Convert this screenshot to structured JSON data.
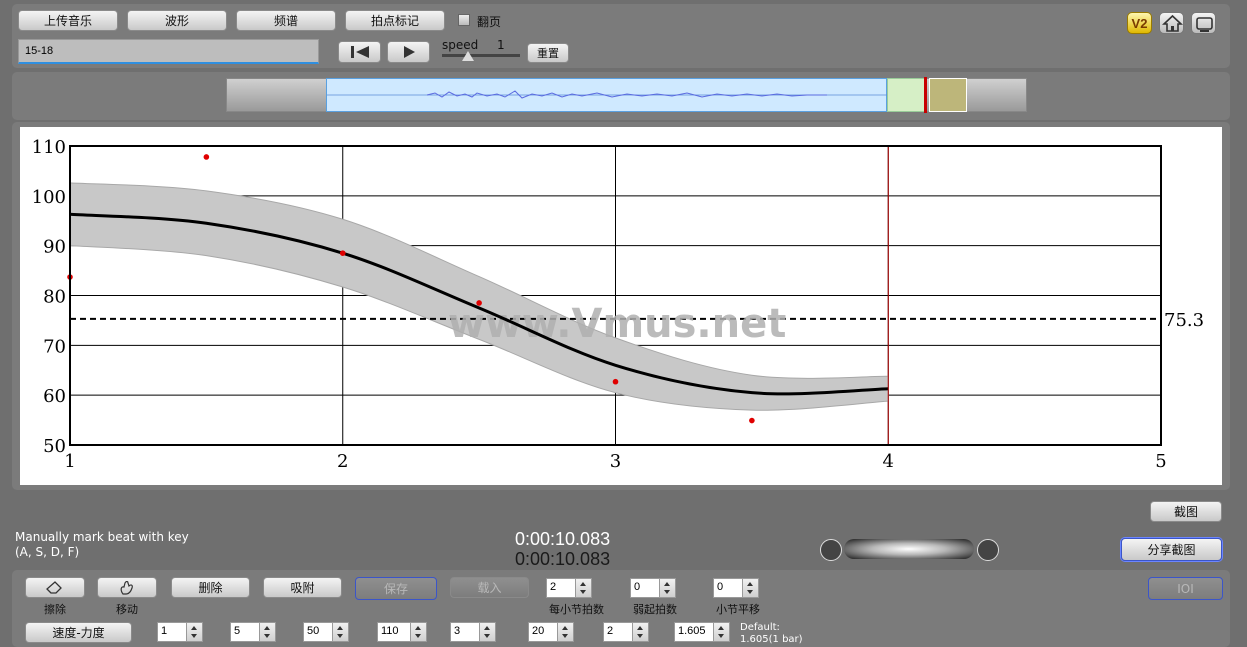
{
  "toolbar": {
    "upload_label": "上传音乐",
    "waveform_label": "波形",
    "spectrum_label": "频谱",
    "beat_mark_label": "拍点标记",
    "flip_label": "翻页",
    "file_name": "15-18",
    "speed_label": "speed",
    "speed_value": "1",
    "reset_label": "重置",
    "v2_badge": "V2"
  },
  "chart_data": {
    "type": "line",
    "xlim": [
      1,
      5
    ],
    "ylim": [
      50,
      110
    ],
    "x_ticks": [
      "1",
      "2",
      "3",
      "4",
      "5"
    ],
    "y_ticks": [
      "50",
      "60",
      "70",
      "80",
      "90",
      "100",
      "110"
    ],
    "grid": true,
    "curve": {
      "x": [
        1,
        1.5,
        2,
        2.5,
        3,
        3.5,
        4
      ],
      "y": [
        96.3,
        94.5,
        88.5,
        77.5,
        66,
        60.5,
        61.3
      ]
    },
    "band_halfwidth": [
      6.3,
      6.5,
      6.8,
      6.3,
      5.5,
      3.5,
      2.5
    ],
    "points": [
      {
        "x": 1,
        "y": 83.7
      },
      {
        "x": 1.5,
        "y": 107.8
      },
      {
        "x": 2,
        "y": 88.5
      },
      {
        "x": 2.5,
        "y": 78.5
      },
      {
        "x": 3,
        "y": 62.7
      },
      {
        "x": 3.5,
        "y": 54.9
      }
    ],
    "average_line": 75.3,
    "average_label": "75.3",
    "cursor_x": 4
  },
  "watermark": "www.Vmus.net",
  "status": {
    "hint_line1": "Manually mark beat with key",
    "hint_line2": "(A, S, D, F)",
    "time1": "0:00:10.083",
    "time2": "0:00:10.083"
  },
  "right_controls": {
    "screenshot_label": "截图",
    "share_label": "分享截图",
    "ioi_label": "IOI"
  },
  "bottom": {
    "erase_label": "擦除",
    "move_label": "移动",
    "delete_label": "删除",
    "snap_label": "吸附",
    "save_label": "保存",
    "load_label": "载入",
    "beats_per_bar": "2",
    "beats_per_bar_label": "每小节拍数",
    "pickup": "0",
    "pickup_label": "弱起拍数",
    "bar_shift": "0",
    "bar_shift_label": "小节平移",
    "mode_label": "速度-力度",
    "row2_values": [
      "1",
      "5",
      "50",
      "110",
      "3",
      "20",
      "2",
      "1.605"
    ],
    "default_label": "Default:",
    "default_value": "1.605(1 bar)"
  }
}
